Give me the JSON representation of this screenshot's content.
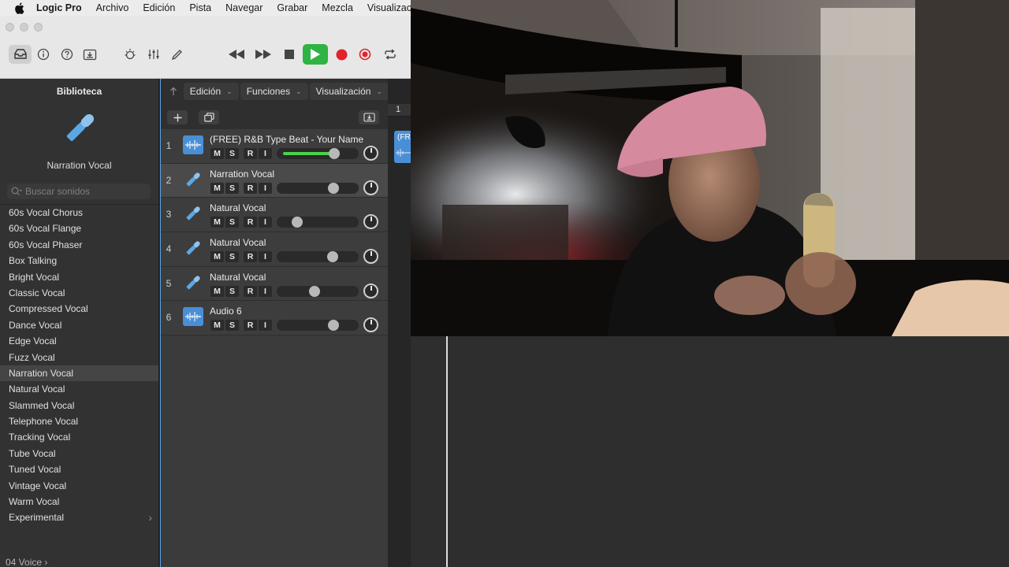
{
  "menubar": {
    "app": "Logic Pro",
    "menus": [
      "Archivo",
      "Edición",
      "Pista",
      "Navegar",
      "Grabar",
      "Mezcla",
      "Visualizació"
    ]
  },
  "library": {
    "title": "Biblioteca",
    "selected_preset": "Narration Vocal",
    "search_placeholder": "Buscar sonidos",
    "items": [
      {
        "label": "60s Vocal Chorus"
      },
      {
        "label": "60s Vocal Flange"
      },
      {
        "label": "60s Vocal Phaser"
      },
      {
        "label": "Box Talking"
      },
      {
        "label": "Bright Vocal"
      },
      {
        "label": "Classic Vocal"
      },
      {
        "label": "Compressed Vocal"
      },
      {
        "label": "Dance Vocal"
      },
      {
        "label": "Edge Vocal"
      },
      {
        "label": "Fuzz Vocal"
      },
      {
        "label": "Narration Vocal"
      },
      {
        "label": "Natural Vocal"
      },
      {
        "label": "Slammed Vocal"
      },
      {
        "label": "Telephone Vocal"
      },
      {
        "label": "Tracking Vocal"
      },
      {
        "label": "Tube Vocal"
      },
      {
        "label": "Tuned Vocal"
      },
      {
        "label": "Vintage Vocal"
      },
      {
        "label": "Warm Vocal"
      },
      {
        "label": "Experimental"
      }
    ],
    "footer": "04 Voice",
    "footer_chevron": "›"
  },
  "tracks_toolbar": {
    "edit": "Edición",
    "functions": "Funciones",
    "view": "Visualización"
  },
  "tracks": [
    {
      "num": "1",
      "name": "(FREE) R&B Type Beat - Your Name",
      "type": "audio",
      "volume": 0.73,
      "meter": 0.8
    },
    {
      "num": "2",
      "name": "Narration Vocal",
      "type": "vocal",
      "volume": 0.72,
      "meter": 0
    },
    {
      "num": "3",
      "name": "Natural Vocal",
      "type": "vocal",
      "volume": 0.21,
      "meter": 0
    },
    {
      "num": "4",
      "name": "Natural Vocal",
      "type": "vocal",
      "volume": 0.71,
      "meter": 0
    },
    {
      "num": "5",
      "name": "Natural Vocal",
      "type": "vocal",
      "volume": 0.45,
      "meter": 0
    },
    {
      "num": "6",
      "name": "Audio 6",
      "type": "audio",
      "volume": 0.72,
      "meter": 0
    }
  ],
  "track_buttons": {
    "mute": "M",
    "solo": "S",
    "record": "R",
    "input": "I"
  },
  "arrange": {
    "ruler_bar": "1",
    "region_label": "(FR"
  },
  "colors": {
    "accent_blue": "#4a8fd6",
    "play_green": "#2fb344",
    "record_red": "#e0232c",
    "meter_green": "#4bd04b"
  }
}
